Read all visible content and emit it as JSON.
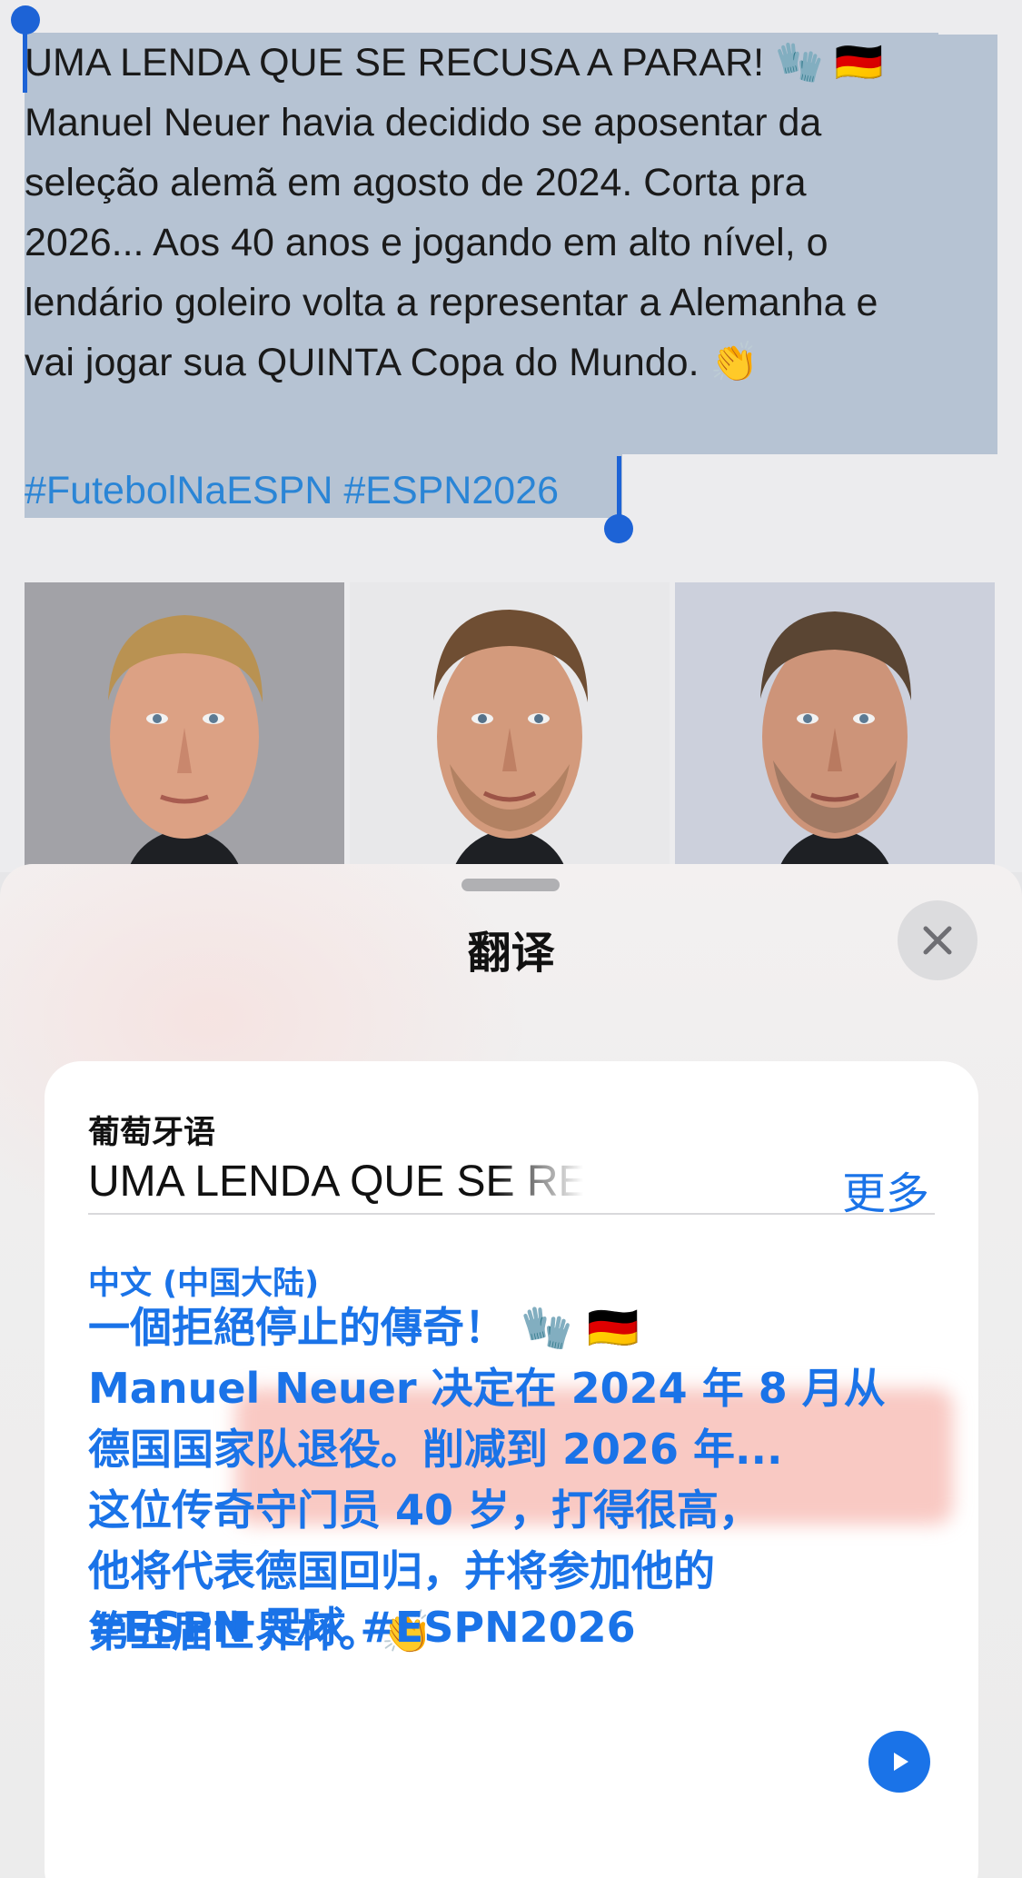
{
  "tweet": {
    "text": "UMA LENDA QUE SE RECUSA A PARAR! 🧤 🇩🇪\nManuel Neuer havia decidido se aposentar da\nseleção alemã em agosto de 2024. Corta pra\n2026... Aos 40 anos e jogando em alto nível, o\nlendário goleiro volta a representar a Alemanha e\nvai jogar sua QUINTA Copa do Mundo. 👏",
    "hashtags": "#FutebolNaESPN #ESPN2026"
  },
  "translate_sheet": {
    "title": "翻译",
    "close_icon": "xmark-icon",
    "source_language": "葡萄牙语",
    "source_text": "UMA LENDA QUE SE RECUSA A PARAR!",
    "more_label": "更多",
    "target_language": "中文 (中国大陆)",
    "target_text": "一個拒絕停止的傳奇！ 🧤 🇩🇪\nManuel Neuer 决定在 2024 年 8 月从\n德国国家队退役。削减到 2026 年...\n这位传奇守门员 40 岁，打得很高，\n他将代表德国回归，并将参加他的\n第五届世界杯。👏",
    "target_hashtags": "#ESPN 足球 #ESPN2026",
    "play_icon": "play-icon"
  },
  "colors": {
    "accent": "#1a73e8",
    "selection": "#b6c3d3",
    "selection_handle": "#1d63d6"
  }
}
